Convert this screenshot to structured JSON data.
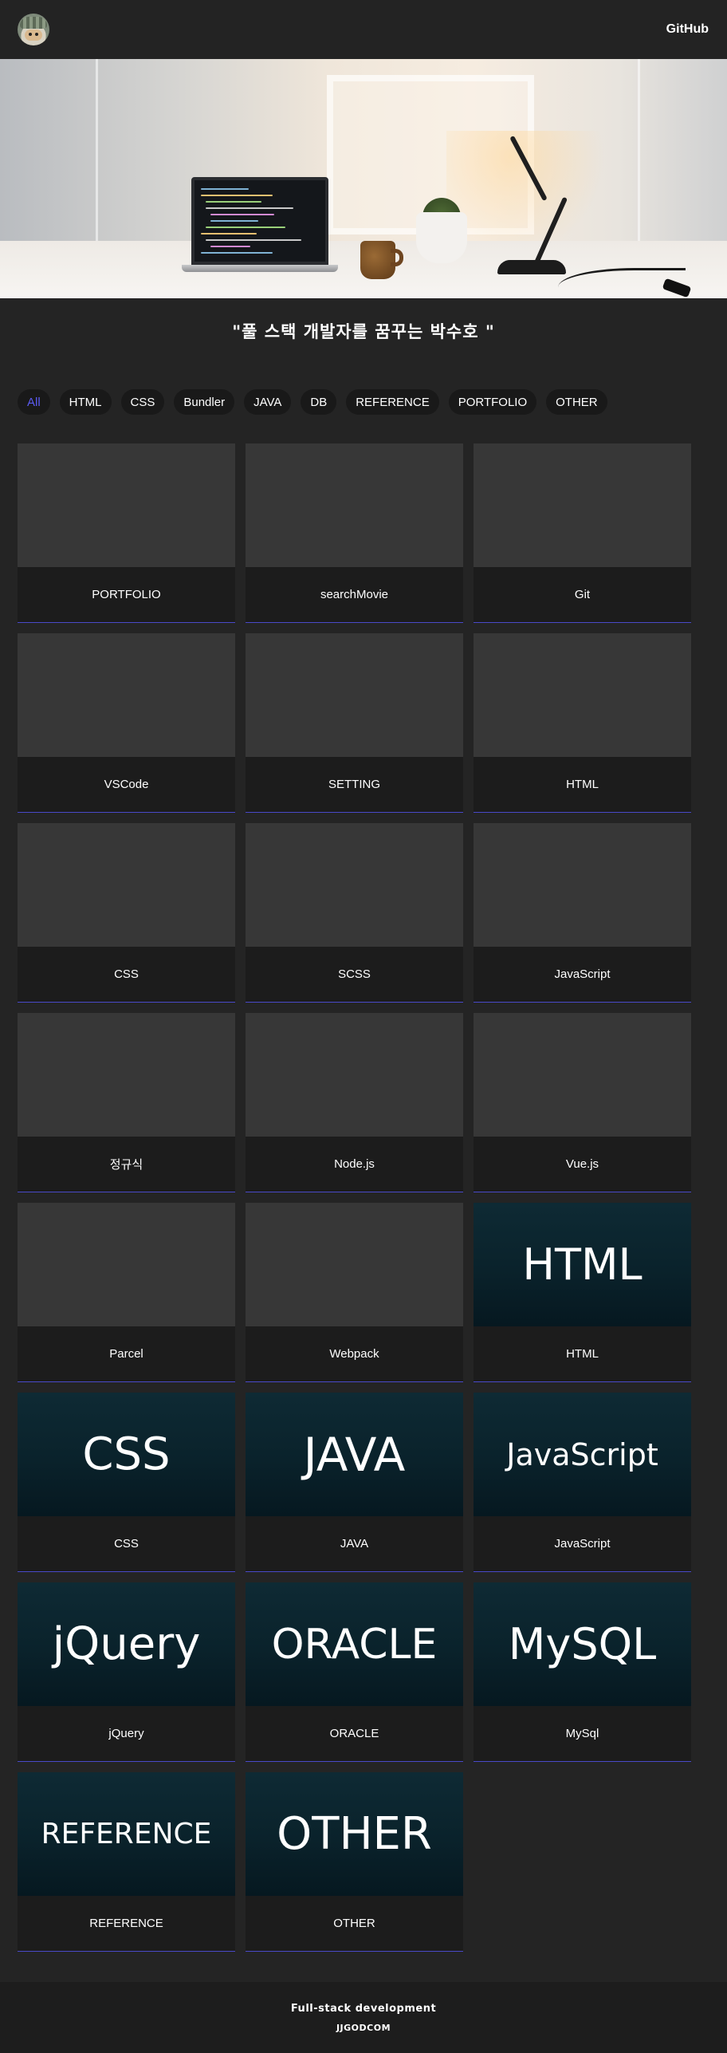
{
  "header": {
    "logo_icon": "avatar-logo-icon",
    "github_label": "GitHub"
  },
  "hero": {
    "image": "desk-with-laptop-lamp-photo"
  },
  "slogan": "\"풀 스택 개발자를 꿈꾸는 박수호 \"",
  "filters": {
    "active_color": "#5b5bf2",
    "items": [
      "All",
      "HTML",
      "CSS",
      "Bundler",
      "JAVA",
      "DB",
      "REFERENCE",
      "PORTFOLIO",
      "OTHER"
    ]
  },
  "cards": [
    {
      "caption": "PORTFOLIO",
      "thumb": ""
    },
    {
      "caption": "searchMovie",
      "thumb": ""
    },
    {
      "caption": "Git",
      "thumb": ""
    },
    {
      "caption": "VSCode",
      "thumb": ""
    },
    {
      "caption": "SETTING",
      "thumb": ""
    },
    {
      "caption": "HTML",
      "thumb": ""
    },
    {
      "caption": "CSS",
      "thumb": ""
    },
    {
      "caption": "SCSS",
      "thumb": ""
    },
    {
      "caption": "JavaScript",
      "thumb": ""
    },
    {
      "caption": "정규식",
      "thumb": ""
    },
    {
      "caption": "Node.js",
      "thumb": ""
    },
    {
      "caption": "Vue.js",
      "thumb": ""
    },
    {
      "caption": "Parcel",
      "thumb": ""
    },
    {
      "caption": "Webpack",
      "thumb": ""
    },
    {
      "caption": "HTML",
      "thumb": "HTML"
    },
    {
      "caption": "CSS",
      "thumb": "CSS"
    },
    {
      "caption": "JAVA",
      "thumb": "JAVA"
    },
    {
      "caption": "JavaScript",
      "thumb": "JavaScript"
    },
    {
      "caption": "jQuery",
      "thumb": "jQuery"
    },
    {
      "caption": "ORACLE",
      "thumb": "ORACLE"
    },
    {
      "caption": "MySql",
      "thumb": "MySQL"
    },
    {
      "caption": "REFERENCE",
      "thumb": "REFERENCE"
    },
    {
      "caption": "OTHER",
      "thumb": "OTHER"
    }
  ],
  "footer": {
    "line1": "Full-stack development",
    "line2": "JJGODCOM"
  },
  "colors": {
    "background": "#242424",
    "card_placeholder": "#373737",
    "caption_bg": "#1c1c1c",
    "caption_underline": "#4949c9",
    "thumb_teal": "#0e2a34"
  }
}
